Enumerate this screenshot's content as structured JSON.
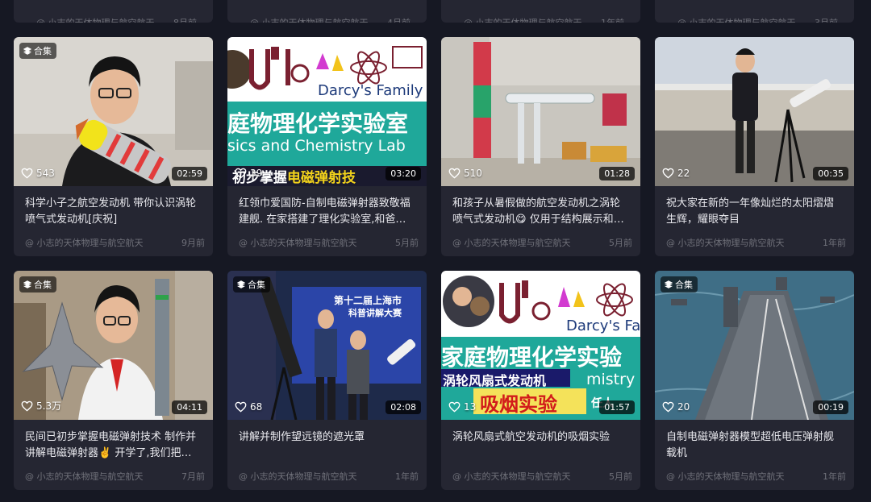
{
  "colors": {
    "background": "#161823",
    "card": "#252632",
    "text": "#e9e9ee",
    "muted": "#6f7079"
  },
  "icons": {
    "collection": "layers-icon",
    "likes": "heart-icon"
  },
  "top_row": [
    {
      "author": "@ 小志的天体物理与航空航天",
      "time": "8月前"
    },
    {
      "author": "@ 小志的天体物理与航空航天",
      "time": "4月前"
    },
    {
      "author": "@ 小志的天体物理与航空航天",
      "time": "1年前"
    },
    {
      "author": "@ 小志的天体物理与航空航天",
      "time": "3月前"
    }
  ],
  "videos": [
    {
      "badge": "合集",
      "likes": "543",
      "duration": "02:59",
      "title": "科学小子之航空发动机 带你认识涡轮喷气式发动机[庆祝]",
      "author": "@ 小志的天体物理与航空航天",
      "time": "9月前"
    },
    {
      "badge": "",
      "likes": "39",
      "duration": "03:20",
      "title": "红领巾爱国防-自制电磁弹射器致敬福建舰. 在家搭建了理化实验室,和爸爸一起做实验",
      "author": "@ 小志的天体物理与航空航天",
      "time": "5月前",
      "overlay": {
        "brand": "Darcy's Family",
        "cn": "庭物理化学实验室",
        "en": "sics and Chemistry Lab",
        "sub_a": "初步掌握",
        "sub_b": "电磁弹射技"
      }
    },
    {
      "badge": "",
      "likes": "510",
      "duration": "01:28",
      "title": "和孩子从暑假做的航空发动机之涡轮喷气式发动机😋 仅用于结构展示和原理讲解",
      "author": "@ 小志的天体物理与航空航天",
      "time": "5月前"
    },
    {
      "badge": "",
      "likes": "22",
      "duration": "00:35",
      "title": "祝大家在新的一年像灿烂的太阳熠熠生辉，耀眼夺目",
      "author": "@ 小志的天体物理与航空航天",
      "time": "1年前"
    },
    {
      "badge": "合集",
      "likes": "5.3万",
      "duration": "04:11",
      "title": "民间已初步掌握电磁弹射技术 制作并讲解电磁弹射器✌️ 开学了,我们把做好的作品带到学校",
      "author": "@ 小志的天体物理与航空航天",
      "time": "7月前"
    },
    {
      "badge": "合集",
      "likes": "68",
      "duration": "02:08",
      "title": "讲解并制作望远镜的遮光罩",
      "author": "@ 小志的天体物理与航空航天",
      "time": "1年前",
      "overlay": {
        "banner": "第十二届上海市",
        "banner2": "科普讲解大赛"
      }
    },
    {
      "badge": "",
      "likes": "13",
      "duration": "01:57",
      "title": "涡轮风扇式航空发动机的吸烟实验",
      "author": "@ 小志的天体物理与航空航天",
      "time": "5月前",
      "overlay": {
        "brand": "Darcy's Fa",
        "cn": "家庭物理化学实验",
        "sub": "涡轮风扇式发动机",
        "en": "mistry",
        "red": "吸烟实验",
        "tail": "任人"
      }
    },
    {
      "badge": "合集",
      "likes": "20",
      "duration": "00:19",
      "title": "自制电磁弹射器模型超低电压弹射舰载机",
      "author": "@ 小志的天体物理与航空航天",
      "time": "1年前"
    }
  ]
}
